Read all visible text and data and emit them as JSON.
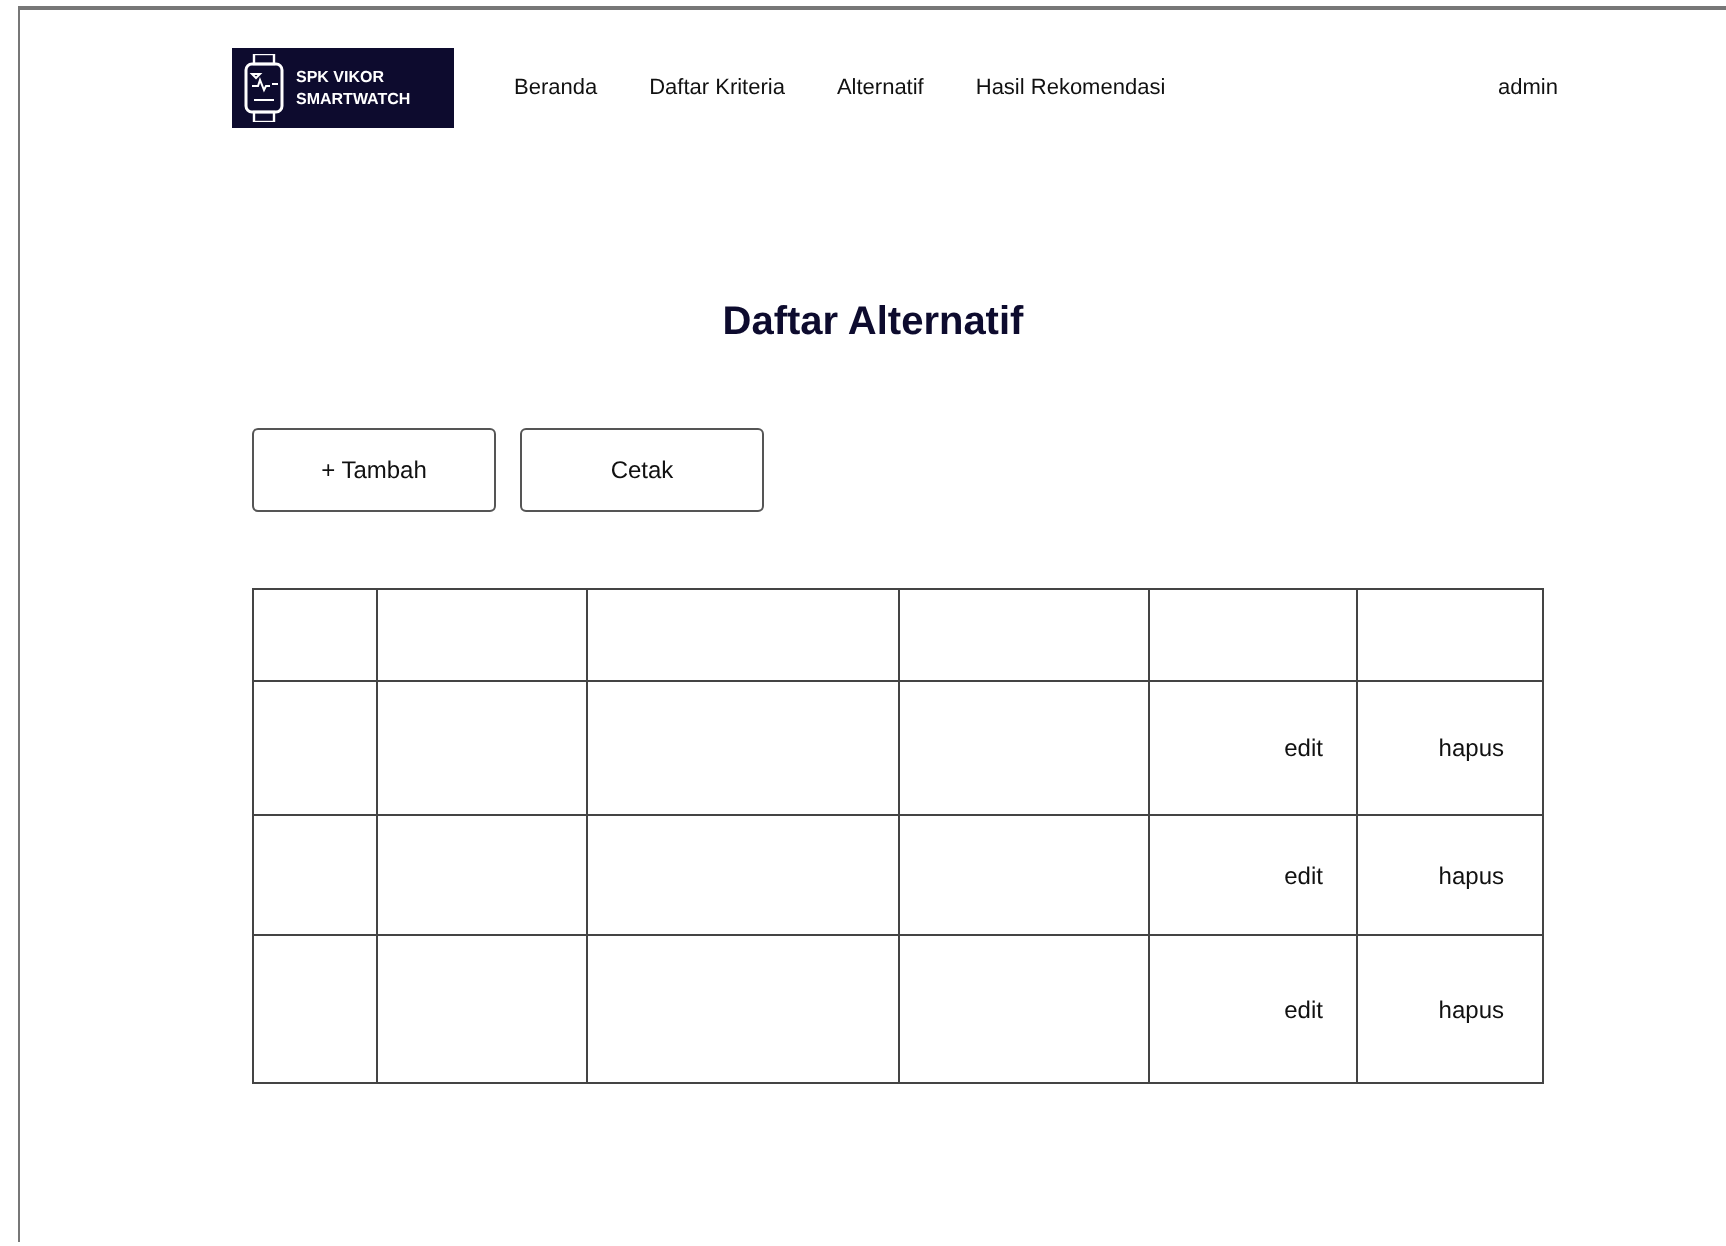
{
  "logo": {
    "lines": [
      "SPK VIKOR",
      "SMARTWATCH"
    ]
  },
  "nav": {
    "items": [
      "Beranda",
      "Daftar Kriteria",
      "Alternatif",
      "Hasil Rekomendasi"
    ],
    "user": "admin"
  },
  "title": "Daftar Alternatif",
  "buttons": [
    "+ Tambah",
    "Cetak"
  ],
  "table": {
    "rows": [
      {
        "actions": [
          "edit",
          "hapus"
        ]
      },
      {
        "actions": [
          "edit",
          "hapus"
        ]
      },
      {
        "actions": [
          "edit",
          "hapus"
        ]
      }
    ]
  }
}
